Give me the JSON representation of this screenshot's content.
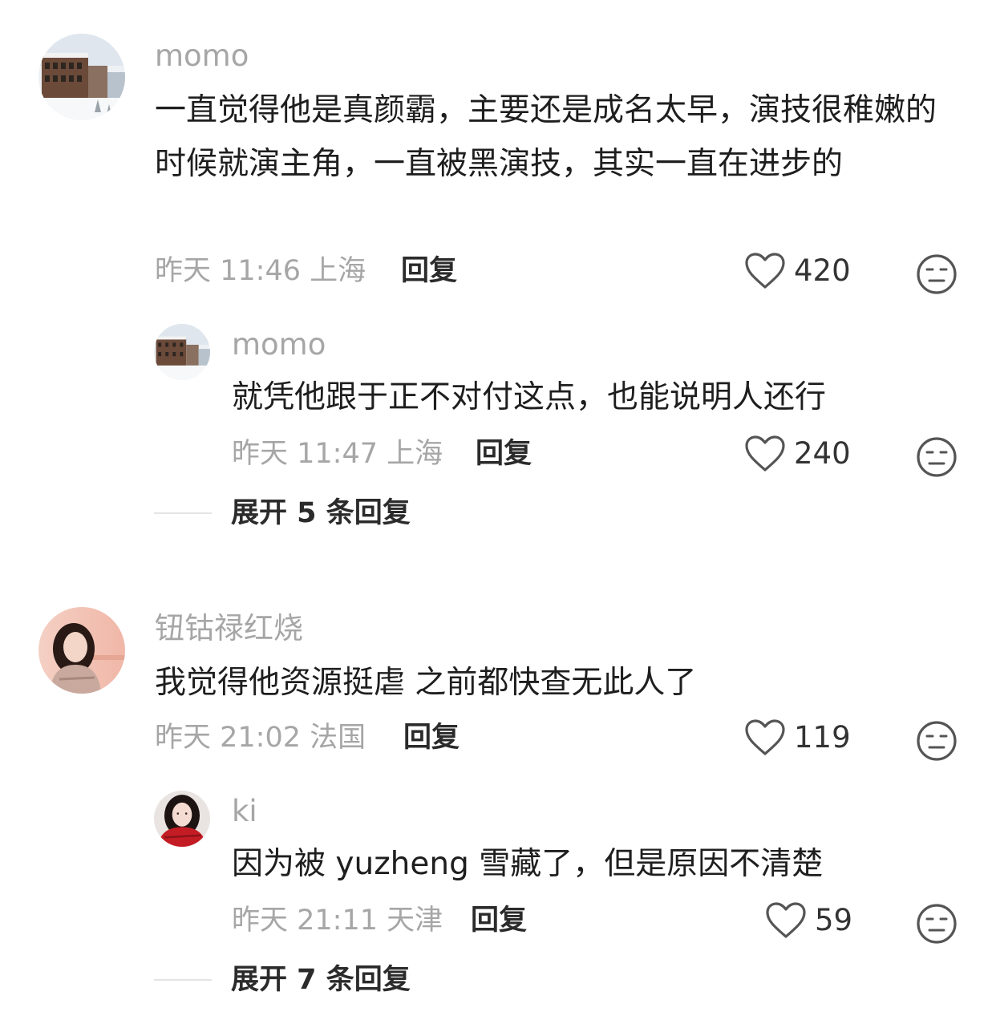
{
  "comments": [
    {
      "username": "momo",
      "avatar_icon": "snowy-building-avatar",
      "text": "一直觉得他是真颜霸，主要还是成名太早，演技很稚嫩的时候就演主角，一直被黑演技，其实一直在进步的",
      "meta": "昨天 11:46 上海",
      "reply_label": "回复",
      "likes": "420",
      "reply": {
        "username": "momo",
        "avatar_icon": "snowy-building-avatar",
        "text": "就凭他跟于正不对付这点，也能说明人还行",
        "meta": "昨天 11:47 上海",
        "reply_label": "回复",
        "likes": "240"
      },
      "expand_label": "展开 5 条回复"
    },
    {
      "username": "钮钴禄红烧",
      "avatar_icon": "woman-portrait-avatar",
      "text": "我觉得他资源挺虐 之前都快查无此人了",
      "meta": "昨天 21:02 法国",
      "reply_label": "回复",
      "likes": "119",
      "reply": {
        "username": "ki",
        "avatar_icon": "woman-red-scarf-avatar",
        "text": "因为被 yuzheng 雪藏了，但是原因不清楚",
        "meta": "昨天 21:11 天津",
        "reply_label": "回复",
        "likes": "59"
      },
      "expand_label": "展开 7 条回复"
    }
  ],
  "colors": {
    "meta_gray": "#a6a6a6",
    "body_text": "#1e1e1e",
    "icon_stroke": "#555555"
  }
}
